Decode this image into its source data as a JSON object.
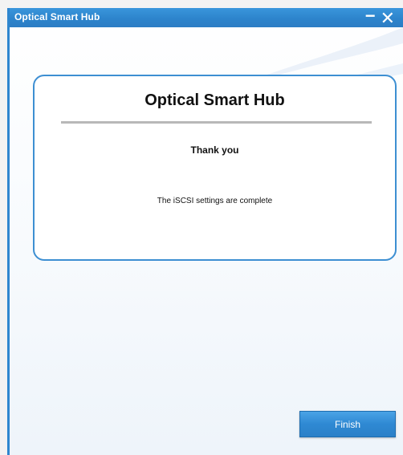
{
  "window": {
    "title": "Optical Smart Hub",
    "minimize_glyph": "−",
    "close_glyph": "✕"
  },
  "card": {
    "title": "Optical Smart Hub",
    "subtitle": "Thank you",
    "message": "The iSCSI settings are complete"
  },
  "actions": {
    "finish_label": "Finish"
  },
  "colors": {
    "titlebar": "#2d84cc",
    "accent_border": "#3d8fd2",
    "button": "#2f89d3"
  }
}
